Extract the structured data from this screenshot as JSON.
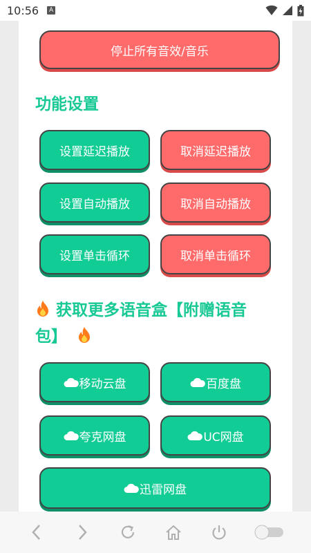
{
  "status_bar": {
    "time": "10:56",
    "notification_letter": "A"
  },
  "buttons": {
    "stop_all": "停止所有音效/音乐",
    "set_delay": "设置延迟播放",
    "cancel_delay": "取消延迟播放",
    "set_auto": "设置自动播放",
    "cancel_auto": "取消自动播放",
    "set_loop": "设置单击循环",
    "cancel_loop": "取消单击循环"
  },
  "sections": {
    "function_settings": "功能设置",
    "more_voice_boxes_line1": "获取更多语音盒【附赠语音",
    "more_voice_boxes_line2": "包】"
  },
  "cloud_links": {
    "mobile_cloud": "移动云盘",
    "baidu": "百度盘",
    "quark": "夸克网盘",
    "uc": "UC网盘",
    "xunlei": "迅雷网盘"
  },
  "colors": {
    "green": "#12cc96",
    "red": "#ff6b6b",
    "heading": "#18c995"
  },
  "icons": [
    "cloud-icon",
    "fire-icon",
    "wifi-icon",
    "signal-icon",
    "battery-icon",
    "back-icon",
    "forward-icon",
    "refresh-icon",
    "home-icon",
    "power-icon",
    "toggle-icon"
  ]
}
